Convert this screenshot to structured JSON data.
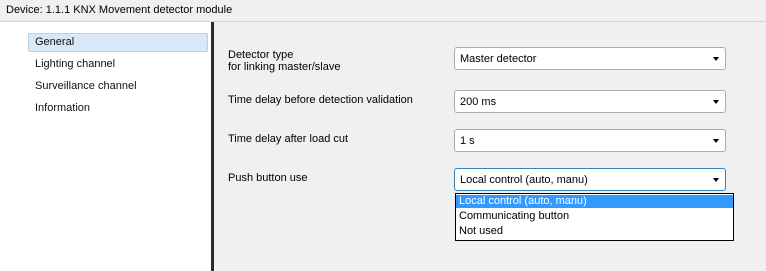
{
  "window": {
    "title": "Device: 1.1.1  KNX Movement detector module"
  },
  "sidebar": {
    "items": [
      {
        "label": "General",
        "selected": true
      },
      {
        "label": "Lighting channel",
        "selected": false
      },
      {
        "label": "Surveillance channel",
        "selected": false
      },
      {
        "label": "Information",
        "selected": false
      }
    ]
  },
  "params": [
    {
      "label": "Detector type",
      "sublabel": "for linking master/slave",
      "value": "Master detector"
    },
    {
      "label": "Time delay before detection validation",
      "value": "200 ms"
    },
    {
      "label": "Time delay after load cut",
      "value": "1 s"
    },
    {
      "label": "Push button use",
      "value": "Local control (auto, manu)"
    }
  ],
  "dropdown": {
    "options": [
      {
        "label": "Local control (auto, manu)",
        "selected": true
      },
      {
        "label": "Communicating button",
        "selected": false
      },
      {
        "label": "Not used",
        "selected": false
      }
    ]
  },
  "colors": {
    "selection": "#3399ff",
    "sidebar_selected": "#d9e8f7",
    "panel_bg": "#f0f0f0",
    "divider": "#2b2b2b"
  },
  "icons": [
    "chevron-down-icon"
  ]
}
